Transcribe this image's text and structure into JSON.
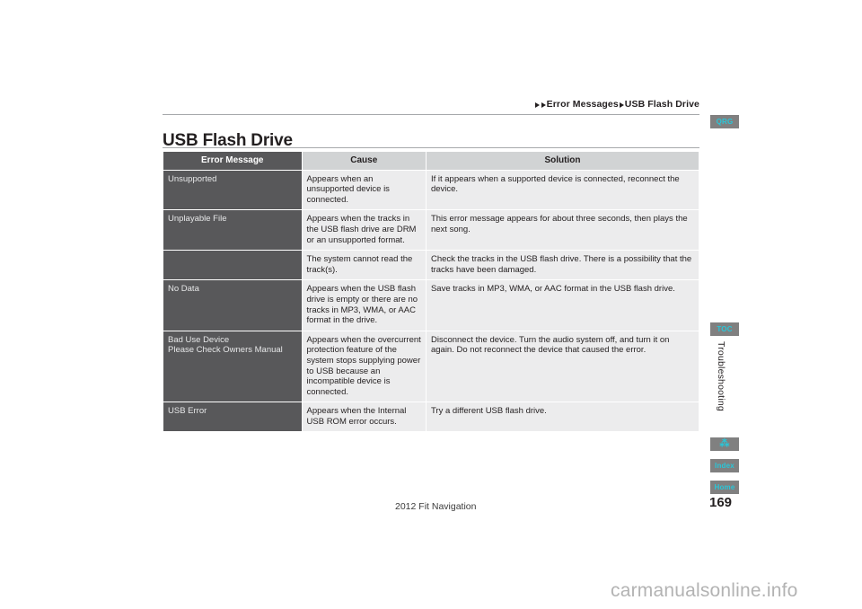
{
  "breadcrumb": {
    "parts": [
      "Error Messages",
      "USB Flash Drive"
    ]
  },
  "page": {
    "title": "USB Flash Drive",
    "number": "169",
    "footer_title": "2012 Fit Navigation",
    "section_label": "Troubleshooting",
    "watermark": "carmanualsonline.info"
  },
  "table": {
    "headers": {
      "error": "Error Message",
      "cause": "Cause",
      "solution": "Solution"
    },
    "rows": [
      {
        "error": "Unsupported",
        "cause": "Appears when an unsupported device is connected.",
        "solution": "If it appears when a supported device is connected, reconnect the device."
      },
      {
        "error": "Unplayable File",
        "cause": "Appears when the tracks in the USB flash drive are DRM or an unsupported format.",
        "solution": "This error message appears for about three seconds, then plays the next song."
      },
      {
        "error": "",
        "cause": "The system cannot read the track(s).",
        "solution": "Check the tracks in the USB flash drive. There is a possibility that the tracks have been damaged."
      },
      {
        "error": "No Data",
        "cause": "Appears when the USB flash drive is empty or there are no tracks in MP3, WMA, or AAC format in the drive.",
        "solution": "Save tracks in MP3, WMA, or AAC format in the USB flash drive."
      },
      {
        "error": "Bad Use Device\nPlease Check Owners Manual",
        "cause": "Appears when the overcurrent protection feature of the system stops supplying power to USB because an incompatible device is connected.",
        "solution": "Disconnect the device. Turn the audio system off, and turn it on again. Do not reconnect the device that caused the error."
      },
      {
        "error": "USB Error",
        "cause": "Appears when the Internal USB ROM error occurs.",
        "solution": "Try a different USB flash drive."
      }
    ]
  },
  "sidenav": {
    "qrg": "QRG",
    "toc": "TOC",
    "index": "Index",
    "home": "Home",
    "glyph": "⁂"
  },
  "colors": {
    "header_dark": "#58585a",
    "header_light": "#d1d3d4",
    "cell_light": "#ececed",
    "accent_cyan": "#29c6d8",
    "button_gray": "#808080"
  }
}
